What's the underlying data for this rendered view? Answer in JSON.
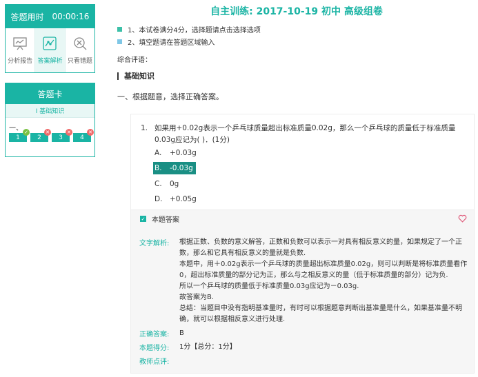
{
  "timer": {
    "label": "答题用时",
    "time": "00:00:16"
  },
  "tabs": [
    {
      "label": "分析报告"
    },
    {
      "label": "答案解析"
    },
    {
      "label": "只看错题"
    }
  ],
  "answer_card": {
    "title": "答题卡",
    "section": "Ⅰ 基础知识",
    "group": "一、",
    "items": [
      {
        "num": "1",
        "status": "correct"
      },
      {
        "num": "2",
        "status": "wrong"
      },
      {
        "num": "3",
        "status": "wrong"
      },
      {
        "num": "4",
        "status": "wrong"
      }
    ]
  },
  "header": {
    "title": "自主训练: 2017-10-19 初中 高级组卷",
    "notes": [
      "1、本试卷满分4分，选择题请点击选择选项",
      "2、填空题请在答题区域输入"
    ],
    "note_colors": [
      "#3cc0a8",
      "#7fc7e6"
    ],
    "evaluation": "综合评语："
  },
  "section": {
    "title": "基础知识",
    "part": "一、根据题意，选择正确答案。"
  },
  "question": {
    "number": "1.",
    "text": "如果用+0.02g表示一个乒乓球质量超出标准质量0.02g，那么一个乒乓球的质量低于标准质量0.03g应记为(    )．(1分)",
    "options": [
      {
        "letter": "A.",
        "text": "+0.03g"
      },
      {
        "letter": "B.",
        "text": "-0.03g"
      },
      {
        "letter": "C.",
        "text": "0g"
      },
      {
        "letter": "D.",
        "text": "+0.05g"
      }
    ],
    "selected": "B"
  },
  "answer_label": "本题答案",
  "explanation": {
    "label": "文字解析:",
    "lines": [
      "根据正数、负数的意义解答，正数和负数可以表示一对具有相反意义的量，如果规定了一个正数，那么和它具有相反意义的量就是负数.",
      "本题中，用＋0.02g表示一个乒乓球的质量超出标准质量0.02g，则可以判断是将标准质量看作0，超出标准质量的部分记为正，那么与之相反意义的量（低于标准质量的部分）记为负.",
      "所以一个乒乓球的质量低于标准质量0.03g应记为－0.03g.",
      "故答案为B.",
      "总结：当题目中没有指明基准量时，有时可以根据题意判断出基准量是什么，如果基准量不明确，就可以根据相反意义进行处理."
    ]
  },
  "correct": {
    "label": "正确答案:",
    "value": "B"
  },
  "score": {
    "label": "本题得分:",
    "value": "1分【总分：1分】"
  },
  "teacher": {
    "label": "教师点评:",
    "value": ""
  },
  "colors": {
    "accent": "#1ab4a4",
    "selected": "#1a8f84",
    "wrong": "#f06a6a",
    "right": "#7ac143"
  }
}
